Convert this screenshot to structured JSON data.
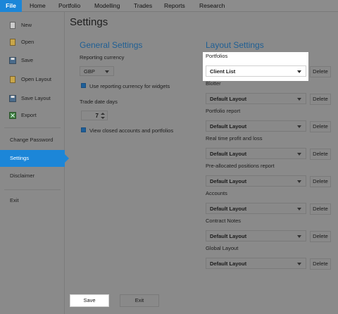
{
  "menubar": {
    "items": [
      "File",
      "Home",
      "Portfolio",
      "Modelling",
      "Trades",
      "Reports",
      "Research"
    ]
  },
  "sidebar": {
    "items": [
      {
        "label": "New",
        "icon": "new-file-icon"
      },
      {
        "label": "Open",
        "icon": "open-file-icon"
      },
      {
        "label": "Save",
        "icon": "save-icon"
      },
      {
        "label": "Open Layout",
        "icon": "open-layout-icon"
      },
      {
        "label": "Save Layout",
        "icon": "save-layout-icon"
      },
      {
        "label": "Export",
        "icon": "export-icon"
      },
      {
        "label": "Change Password"
      },
      {
        "label": "Settings"
      },
      {
        "label": "Disclaimer"
      },
      {
        "label": "Exit"
      }
    ],
    "active": "Settings"
  },
  "page": {
    "title": "Settings"
  },
  "general": {
    "heading": "General Settings",
    "reporting_currency_label": "Reporting currency",
    "currency_value": "GBP",
    "use_reporting_currency_label": "Use reporting currency for widgets",
    "trade_date_days_label": "Trade date days",
    "trade_date_days_value": "7",
    "view_closed_label": "View closed accounts and portfolios"
  },
  "layout": {
    "heading": "Layout Settings",
    "delete_label": "Delete",
    "rows": [
      {
        "label": "Portfolios",
        "value": "Client List"
      },
      {
        "label": "Blotter",
        "value": "Default Layout"
      },
      {
        "label": "Portfolio report",
        "value": "Default Layout"
      },
      {
        "label": "Real time profit and loss",
        "value": "Default Layout"
      },
      {
        "label": "Pre-allocated positions report",
        "value": "Default Layout"
      },
      {
        "label": "Accounts",
        "value": "Default Layout"
      },
      {
        "label": "Contract Notes",
        "value": "Default Layout"
      },
      {
        "label": "Global Layout",
        "value": "Default Layout"
      }
    ]
  },
  "footer": {
    "save_label": "Save",
    "exit_label": "Exit"
  },
  "colors": {
    "accent": "#1c86d8",
    "heading": "#1f5f94",
    "dim_background": "#8a8a8a"
  }
}
